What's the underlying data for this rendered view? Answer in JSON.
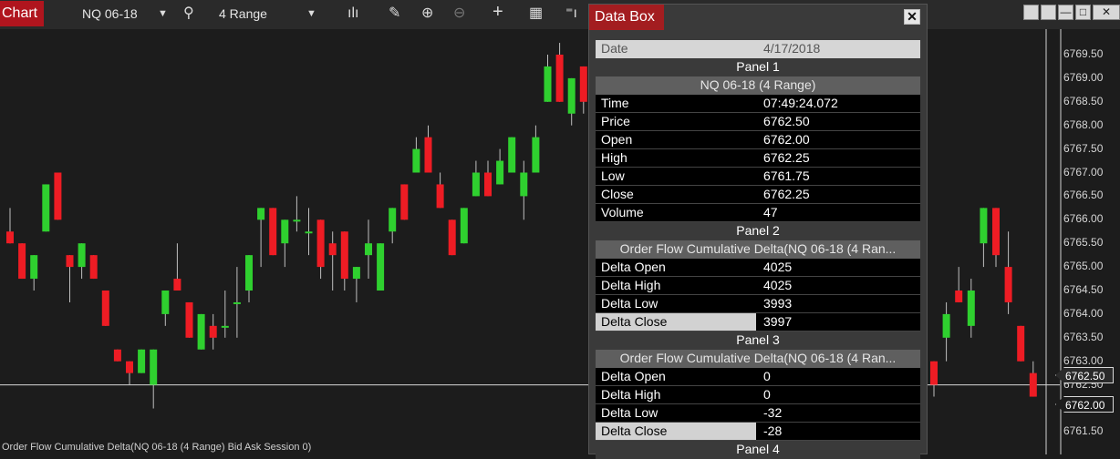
{
  "toolbar": {
    "chart_tab": "Chart",
    "instrument": "NQ 06-18",
    "bar_type": "4 Range",
    "colors": {
      "tab": "#b0151e"
    }
  },
  "chart": {
    "footer_label": "Order Flow Cumulative Delta(NQ 06-18 (4 Range) Bid Ask Session 0)",
    "current_price": "6762.50",
    "crosshair_price": "6762.00",
    "colors": {
      "up": "#2fd02f",
      "down": "#ee1c24",
      "background": "#1c1c1c"
    }
  },
  "chart_data": {
    "type": "candlestick",
    "y_ticks": [
      "6769.50",
      "6769.00",
      "6768.50",
      "6768.00",
      "6767.50",
      "6767.00",
      "6766.50",
      "6766.00",
      "6765.50",
      "6765.00",
      "6764.50",
      "6764.00",
      "6763.50",
      "6763.00",
      "6762.50",
      "6762.00",
      "6761.50"
    ],
    "candles": [
      [
        6765.75,
        6766.25,
        6765.5,
        6765.5
      ],
      [
        6765.5,
        6765.5,
        6764.75,
        6764.75
      ],
      [
        6764.75,
        6765.25,
        6764.5,
        6765.25
      ],
      [
        6765.75,
        6766.75,
        6765.75,
        6766.75
      ],
      [
        6767.0,
        6767.0,
        6766.0,
        6766.0
      ],
      [
        6765.25,
        6765.25,
        6764.25,
        6765.0
      ],
      [
        6765.0,
        6765.5,
        6764.75,
        6765.5
      ],
      [
        6765.25,
        6765.25,
        6764.75,
        6764.75
      ],
      [
        6764.5,
        6764.5,
        6763.75,
        6763.75
      ],
      [
        6763.25,
        6763.25,
        6763.0,
        6763.0
      ],
      [
        6763.0,
        6763.0,
        6762.5,
        6762.75
      ],
      [
        6762.75,
        6763.25,
        6762.75,
        6763.25
      ],
      [
        6762.5,
        6763.25,
        6762.0,
        6763.25
      ],
      [
        6764.0,
        6764.5,
        6763.75,
        6764.5
      ],
      [
        6764.75,
        6765.5,
        6764.5,
        6764.5
      ],
      [
        6764.25,
        6764.25,
        6763.5,
        6763.5
      ],
      [
        6763.25,
        6764.0,
        6763.25,
        6764.0
      ],
      [
        6763.75,
        6764.0,
        6763.25,
        6763.5
      ],
      [
        6763.75,
        6764.5,
        6763.5,
        6763.75
      ],
      [
        6764.25,
        6765.0,
        6763.5,
        6764.25
      ],
      [
        6764.5,
        6765.25,
        6764.25,
        6765.25
      ],
      [
        6766.0,
        6766.25,
        6765.0,
        6766.25
      ],
      [
        6766.25,
        6766.25,
        6765.25,
        6765.25
      ],
      [
        6765.5,
        6766.0,
        6765.0,
        6766.0
      ],
      [
        6766.0,
        6766.5,
        6765.75,
        6766.0
      ],
      [
        6765.75,
        6766.25,
        6765.25,
        6765.75
      ],
      [
        6766.0,
        6766.0,
        6764.75,
        6765.0
      ],
      [
        6765.5,
        6765.75,
        6764.5,
        6765.25
      ],
      [
        6765.75,
        6765.75,
        6764.5,
        6764.75
      ],
      [
        6764.75,
        6765.0,
        6764.25,
        6765.0
      ],
      [
        6765.25,
        6766.0,
        6764.75,
        6765.5
      ],
      [
        6764.5,
        6765.5,
        6764.5,
        6765.5
      ],
      [
        6765.75,
        6766.25,
        6765.5,
        6766.25
      ],
      [
        6766.75,
        6766.75,
        6766.0,
        6766.0
      ],
      [
        6767.0,
        6767.75,
        6767.0,
        6767.5
      ],
      [
        6767.75,
        6768.0,
        6767.0,
        6767.0
      ],
      [
        6766.75,
        6767.0,
        6766.25,
        6766.25
      ],
      [
        6766.0,
        6766.0,
        6765.25,
        6765.25
      ],
      [
        6765.5,
        6766.25,
        6765.5,
        6766.25
      ],
      [
        6766.5,
        6767.25,
        6766.5,
        6767.0
      ],
      [
        6767.0,
        6767.25,
        6766.5,
        6766.5
      ],
      [
        6766.75,
        6767.5,
        6766.75,
        6767.25
      ],
      [
        6767.0,
        6767.75,
        6767.0,
        6767.75
      ],
      [
        6766.5,
        6767.25,
        6766.0,
        6767.0
      ],
      [
        6767.0,
        6768.0,
        6767.0,
        6767.75
      ],
      [
        6768.5,
        6769.5,
        6768.5,
        6769.25
      ],
      [
        6769.5,
        6769.75,
        6768.5,
        6768.5
      ],
      [
        6768.25,
        6769.0,
        6768.0,
        6769.0
      ],
      [
        6769.25,
        6769.25,
        6768.25,
        6768.5
      ],
      [
        6763.0,
        6763.0,
        6762.25,
        6762.5
      ],
      [
        6763.5,
        6764.25,
        6763.0,
        6764.0
      ],
      [
        6764.5,
        6765.0,
        6764.25,
        6764.25
      ],
      [
        6763.75,
        6764.75,
        6763.5,
        6764.5
      ],
      [
        6765.5,
        6766.25,
        6765.0,
        6766.25
      ],
      [
        6766.25,
        6766.25,
        6765.0,
        6765.25
      ],
      [
        6765.0,
        6765.75,
        6764.0,
        6764.25
      ],
      [
        6763.75,
        6763.75,
        6763.0,
        6763.0
      ],
      [
        6762.75,
        6763.0,
        6762.25,
        6762.25
      ]
    ]
  },
  "data_box": {
    "title": "Data Box",
    "date_label": "Date",
    "date_value": "4/17/2018",
    "panels": [
      {
        "header": "Panel 1",
        "series": "NQ 06-18 (4 Range)",
        "rows": [
          [
            "Time",
            "07:49:24.072"
          ],
          [
            "Price",
            "6762.50"
          ],
          [
            "Open",
            "6762.00"
          ],
          [
            "High",
            "6762.25"
          ],
          [
            "Low",
            "6761.75"
          ],
          [
            "Close",
            "6762.25"
          ],
          [
            "Volume",
            "47"
          ]
        ]
      },
      {
        "header": "Panel 2",
        "series": "Order Flow Cumulative Delta(NQ 06-18 (4 Ran...",
        "rows": [
          [
            "Delta Open",
            "4025"
          ],
          [
            "Delta High",
            "4025"
          ],
          [
            "Delta Low",
            "3993"
          ],
          [
            "Delta Close",
            "3997"
          ]
        ]
      },
      {
        "header": "Panel 3",
        "series": "Order Flow Cumulative Delta(NQ 06-18 (4 Ran...",
        "rows": [
          [
            "Delta Open",
            "0"
          ],
          [
            "Delta High",
            "0"
          ],
          [
            "Delta Low",
            "-32"
          ],
          [
            "Delta Close",
            "-28"
          ]
        ]
      },
      {
        "header": "Panel 4"
      }
    ]
  }
}
